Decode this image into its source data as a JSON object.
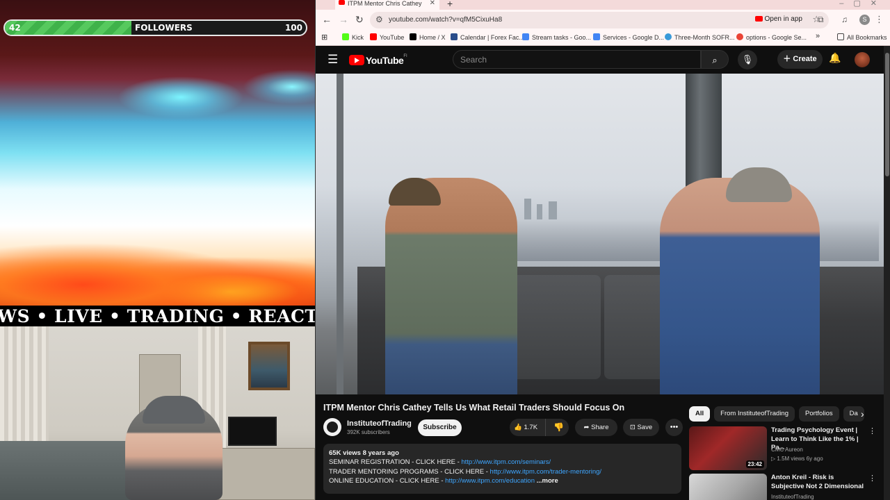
{
  "stream": {
    "followers_current": "42",
    "followers_label": "FOLLOWERS",
    "followers_goal": "100",
    "followers_progress": 0.42,
    "ticker_text": "WS • LIVE • TRADING • REACTIO"
  },
  "browser": {
    "tab_title": "ITPM Mentor Chris Cathey",
    "url": "youtube.com/watch?v=qfM5CixuHa8",
    "open_in_app": "Open in app",
    "profile_initial": "S",
    "bookmarks": [
      {
        "label": "Kick",
        "color": "#53fc18"
      },
      {
        "label": "YouTube",
        "color": "#ff0000"
      },
      {
        "label": "Home / X",
        "color": "#000000"
      },
      {
        "label": "Calendar | Forex Fac...",
        "color": "#2a4c8a"
      },
      {
        "label": "Stream tasks - Goo...",
        "color": "#4285f4"
      },
      {
        "label": "Services - Google D...",
        "color": "#4285f4"
      },
      {
        "label": "Three-Month SOFR...",
        "color": "#3a9ad9"
      },
      {
        "label": "options - Google Se...",
        "color": "#ea4335"
      }
    ],
    "all_bookmarks": "All Bookmarks"
  },
  "youtube": {
    "logo_text": "YouTube",
    "logo_region": "FI",
    "search_placeholder": "Search",
    "create_label": "Create",
    "video_title": "ITPM Mentor Chris Cathey Tells Us What Retail Traders Should Focus On",
    "channel_name": "InstituteofTrading",
    "channel_subs": "392K subscribers",
    "subscribe_label": "Subscribe",
    "likes": "1.7K",
    "share_label": "Share",
    "save_label": "Save",
    "description": {
      "meta": "65K views  8 years ago",
      "line1_text": "SEMINAR REGISTRATION - CLICK HERE - ",
      "line1_link": "http://www.itpm.com/seminars/",
      "line2_text": "TRADER MENTORING PROGRAMS - CLICK HERE - ",
      "line2_link": "http://www.itpm.com/trader-mentoring/",
      "line3_text": "ONLINE EDUCATION - CLICK HERE - ",
      "line3_link": "http://www.itpm.com/education",
      "more": "...more"
    },
    "chips": [
      "All",
      "From InstituteofTrading",
      "Portfolios",
      "Da"
    ],
    "recommendations": [
      {
        "title": "Trading Psychology Event | Learn to Think Like the 1% | Pa...",
        "channel": "CMC Aureon",
        "meta": "1.5M views  6y ago",
        "duration": "23:42"
      },
      {
        "title": "Anton Kreil - Risk is Subjective Not 2 Dimensional",
        "channel": "InstituteofTrading",
        "meta": "",
        "duration": ""
      }
    ]
  }
}
